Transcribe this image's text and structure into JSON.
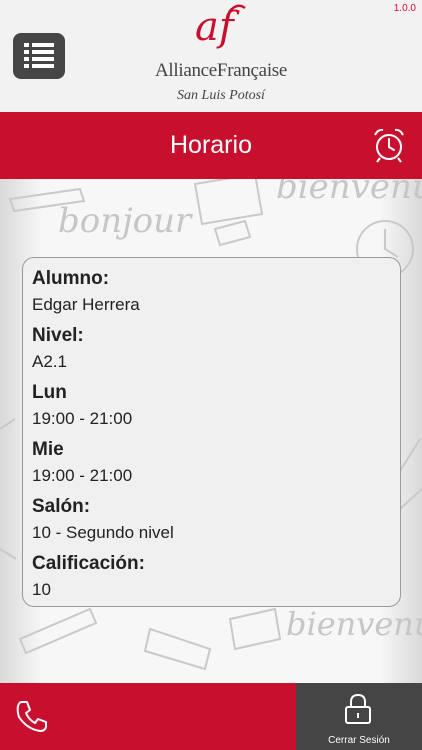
{
  "app": {
    "version": "1.0.0",
    "logo": {
      "mark": "af",
      "name": "AllianceFrançaise",
      "city": "San Luis Potosí"
    }
  },
  "header": {
    "title": "Horario",
    "menu_icon": "list-menu-icon",
    "alarm_icon": "alarm-clock-icon"
  },
  "background_words": [
    "bonjour",
    "bienvenu",
    "bienvenu"
  ],
  "schedule": {
    "fields": [
      {
        "label": "Alumno:",
        "value": "Edgar Herrera"
      },
      {
        "label": "Nivel:",
        "value": "A2.1"
      },
      {
        "label": "Lun",
        "value": "19:00 - 21:00"
      },
      {
        "label": "Mie",
        "value": "19:00 - 21:00"
      },
      {
        "label": "Salón:",
        "value": "10 - Segundo nivel"
      },
      {
        "label": "Calificación:",
        "value": "10"
      }
    ]
  },
  "footer": {
    "phone_icon": "phone-icon",
    "logout_label": "Cerrar Sesión",
    "logout_icon": "lock-icon"
  },
  "colors": {
    "brand_red": "#c8102e",
    "dark_gray": "#454545"
  }
}
